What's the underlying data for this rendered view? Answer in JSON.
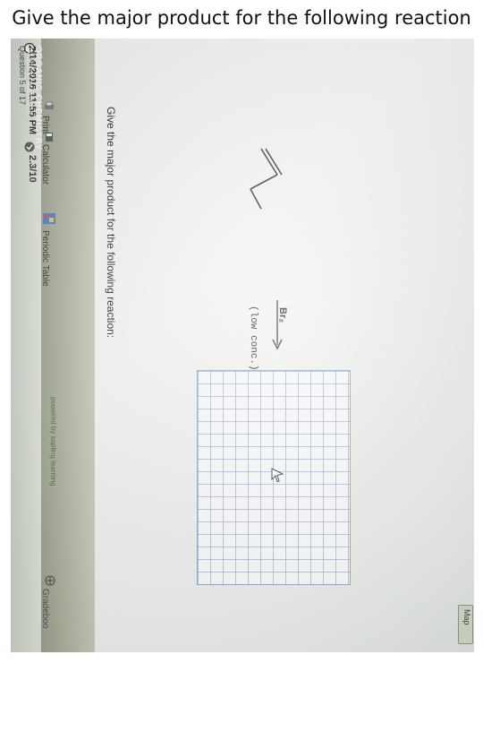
{
  "caption": "Give the major product for the following reaction",
  "toolbar": {
    "datetime": "2/14/2016 11:55 PM",
    "score": "2.3/10",
    "print_label": "Print",
    "calculator_label": "Calculator",
    "periodic_table_label": "Periodic Table",
    "gradebook_label": "Gradeboo",
    "question_counter": "Question 5 of 17"
  },
  "course": {
    "title": "ORGANIC CHEMISTRY",
    "author": "JANICE L. MAXWELL",
    "powered_by": "powered by sapling learning",
    "map_label": "Map"
  },
  "question": {
    "prompt": "Give the major product for the following reaction:",
    "reagent": "Br₂",
    "condition": "(low conc.)"
  },
  "icons": [
    "clock-icon",
    "score-icon",
    "print-icon",
    "calculator-icon",
    "periodic-table-icon",
    "gradebook-icon",
    "cursor-icon"
  ]
}
